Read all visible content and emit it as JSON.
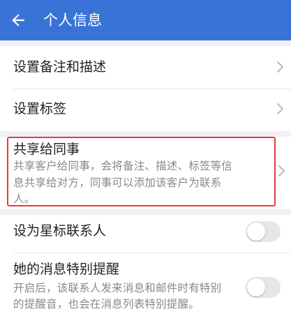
{
  "header": {
    "title": "个人信息"
  },
  "rows": {
    "remark": {
      "label": "设置备注和描述"
    },
    "tags": {
      "label": "设置标签"
    },
    "share": {
      "label": "共享给同事",
      "description_line1": "共享客户给同事，会将备注、描述、标签等信",
      "description_line2": "息共享给对方，同事可以添加该客户为联系",
      "description_line3": "人。"
    },
    "star": {
      "label": "设为星标联系人",
      "toggle_on": false
    },
    "special_remind": {
      "label": "她的消息特别提醒",
      "description_line1": "开启后，该联系人发来消息和邮件时有特别",
      "description_line2": "的提醒音，也会在消息列表特别提醒。",
      "toggle_on": false
    }
  },
  "colors": {
    "appbar": "#3a73d8",
    "highlight": "#e63b3b",
    "toggle_off": "#e6e6e6"
  }
}
